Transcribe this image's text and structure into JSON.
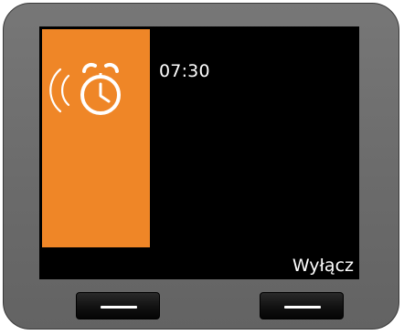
{
  "screen": {
    "alarm_time": "07:30",
    "softkey_right_label": "Wyłącz",
    "alarm_icon": "ringing-alarm-clock-icon"
  },
  "colors": {
    "accent": "#ef8627",
    "screen_background": "#000000",
    "text": "#ffffff",
    "device_body": "#6b6b6b"
  }
}
